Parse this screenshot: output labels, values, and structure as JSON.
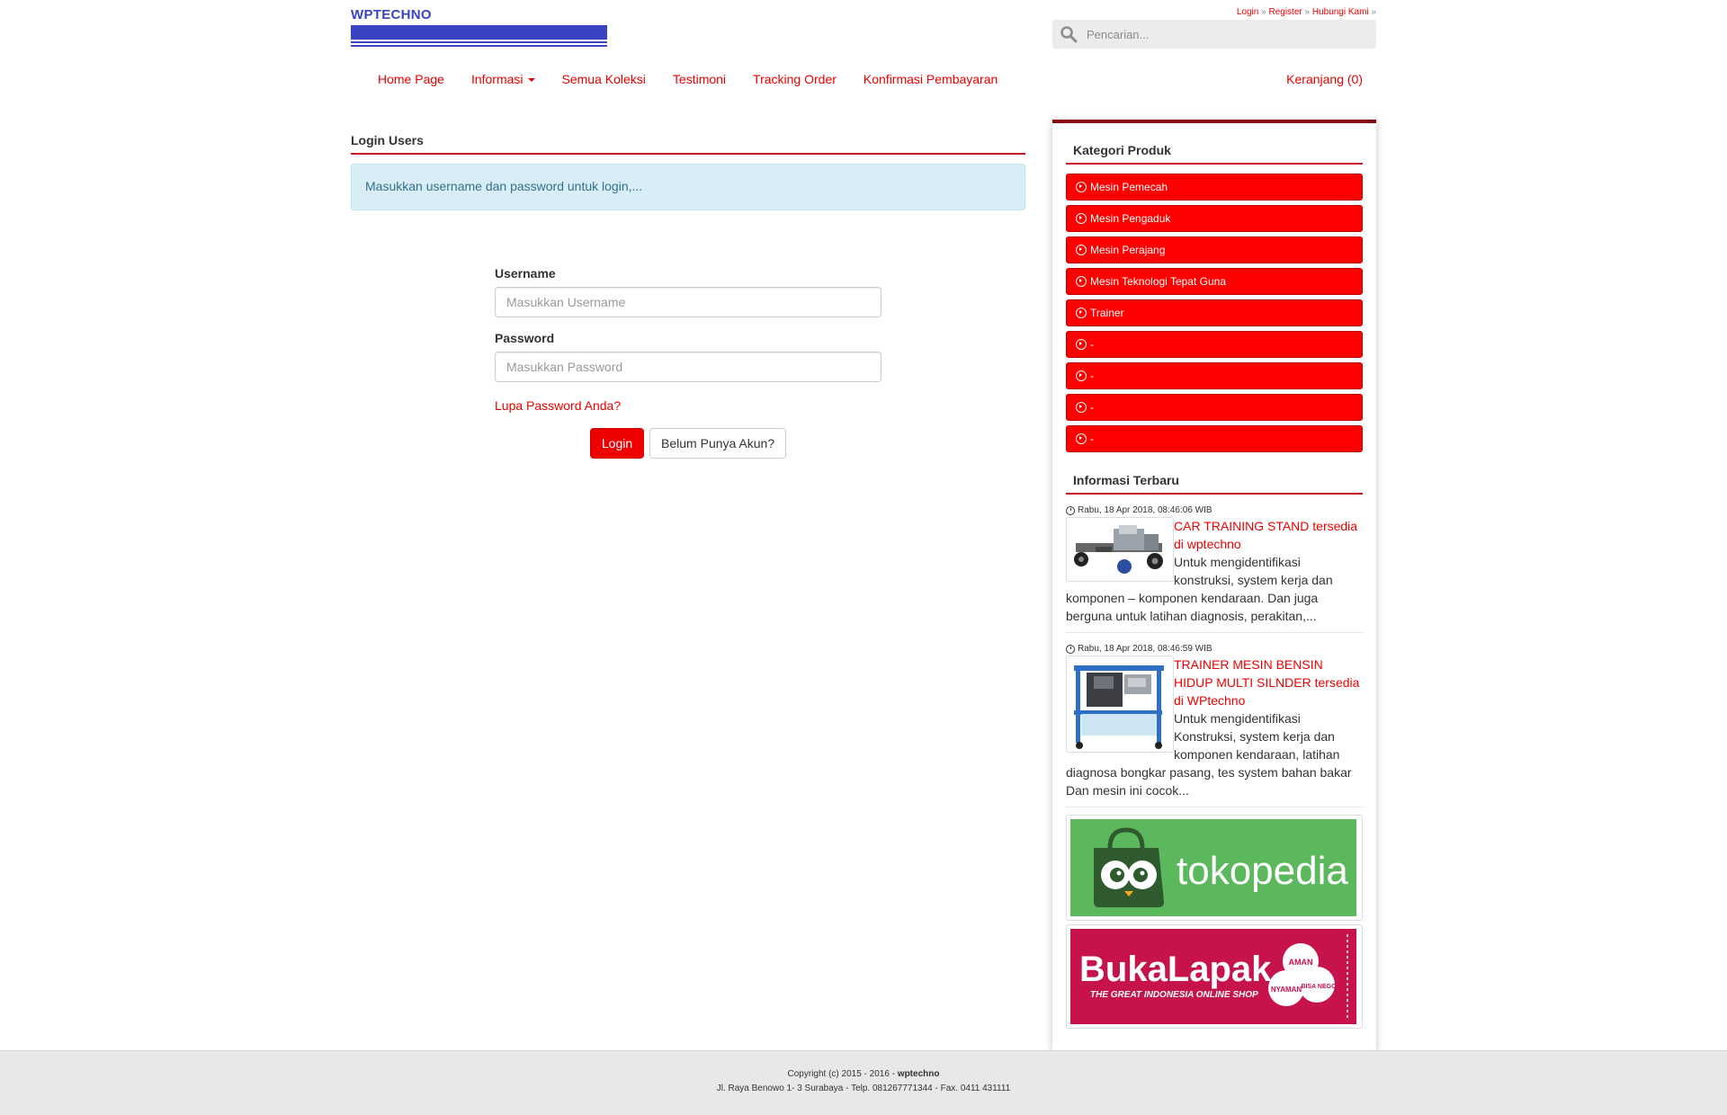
{
  "site": {
    "logo_text": "WPTECHNO"
  },
  "toplinks": {
    "login": "Login",
    "register": "Register",
    "contact": "Hubungi Kami",
    "sep": "»"
  },
  "search": {
    "placeholder": "Pencarian..."
  },
  "nav": {
    "items": [
      "Home Page",
      "Informasi",
      "Semua Koleksi",
      "Testimoni",
      "Tracking Order",
      "Konfirmasi Pembayaran"
    ],
    "cart": "Keranjang (0)"
  },
  "main": {
    "title": "Login Users",
    "alert": "Masukkan username dan password untuk login,...",
    "username_label": "Username",
    "username_placeholder": "Masukkan Username",
    "password_label": "Password",
    "password_placeholder": "Masukkan Password",
    "forgot": "Lupa Password Anda?",
    "login_button": "Login",
    "register_button": "Belum Punya Akun?"
  },
  "sidebar": {
    "categories_title": "Kategori Produk",
    "categories": [
      "Mesin Pemecah",
      "Mesin Pengaduk",
      "Mesin Perajang",
      "Mesin Teknologi Tepat Guna",
      "Trainer",
      "-",
      "-",
      "-",
      "-"
    ],
    "news_title": "Informasi Terbaru",
    "news": [
      {
        "date": "Rabu, 18 Apr 2018, 08:46:06 WIB",
        "title": "CAR TRAINING STAND tersedia di wptechno",
        "excerpt": "Untuk mengidentifikasi konstruksi, system kerja dan komponen – komponen kendaraan. Dan juga berguna untuk latihan diagnosis, perakitan,..."
      },
      {
        "date": "Rabu, 18 Apr 2018, 08:46:59 WIB",
        "title": "TRAINER MESIN BENSIN HIDUP MULTI SILNDER tersedia di WPtechno",
        "excerpt": "Untuk mengidentifikasi Konstruksi, system kerja dan komponen kendaraan, latihan diagnosa bongkar pasang, tes system bahan bakar Dan mesin ini cocok..."
      }
    ],
    "banners": {
      "tokopedia": "tokopedia",
      "bukalapak": "BukaLapak",
      "bukalapak_tagline": "THE GREAT INDONESIA ONLINE SHOP",
      "bukalapak_badges": [
        "AMAN",
        "NYAMAN",
        "BISA NEGO"
      ]
    }
  },
  "footer": {
    "copyright": "Copyright (c) 2015 - 2016 - ",
    "brand": "wptechno",
    "address": "Jl. Raya Benowo 1- 3 Surabaya - Telp. 081267771344 - Fax. 0411 431111"
  },
  "colors": {
    "accent": "#ee0000",
    "logo": "#3a43c2",
    "tokopedia": "#5cb85c",
    "bukalapak": "#c6134b"
  }
}
